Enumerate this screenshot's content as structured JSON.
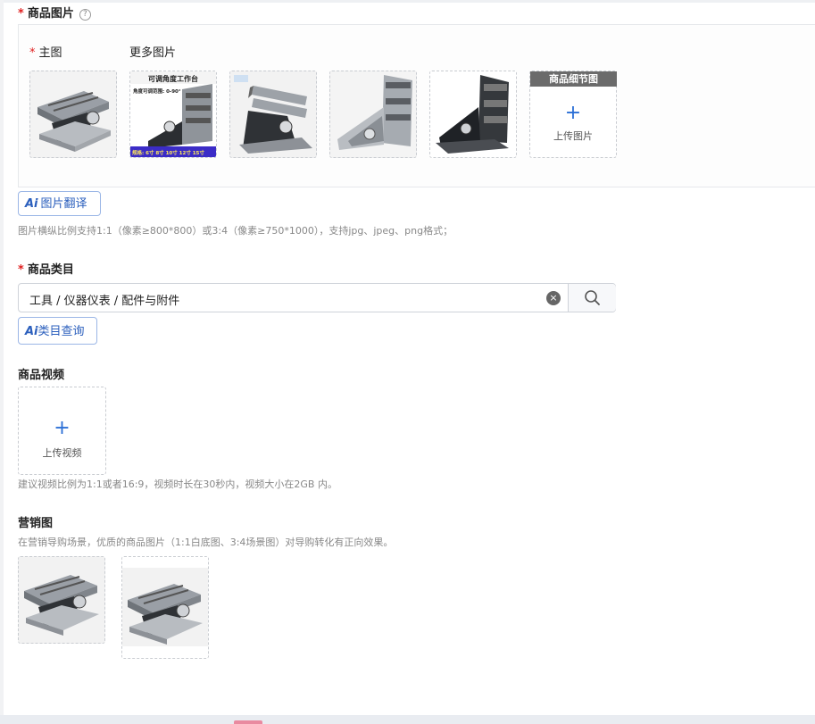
{
  "images_section": {
    "label": "商品图片",
    "help": "?",
    "main_label": "主图",
    "more_label": "更多图片",
    "detail_tag": "商品细节图",
    "upload_plus": "+",
    "upload_text": "上传图片",
    "ai_icon": "Ai",
    "translate_label": "图片翻译",
    "hint": "图片横纵比例支持1:1（像素≥800*800）或3:4（像素≥750*1000），支持jpg、jpeg、png格式；"
  },
  "thumb2_texts": {
    "title": "可调角度工作台",
    "subtitle": "角度可调范围: 0-90°",
    "banner": "规格: 6寸 8寸 10寸 12寸 15寸"
  },
  "category_section": {
    "label": "商品类目",
    "value": "工具 / 仪器仪表 / 配件与附件",
    "clear_icon": "×",
    "ai_icon": "Ai",
    "query_label": "类目查询"
  },
  "video_section": {
    "label": "商品视频",
    "upload_plus": "+",
    "upload_text": "上传视频",
    "hint": "建议视频比例为1:1或者16:9，视频时长在30秒内，视频大小在2GB 内。"
  },
  "marketing_section": {
    "label": "营销图",
    "hint": "在营销导购场景，优质的商品图片（1:1白底图、3:4场景图）对导购转化有正向效果。"
  },
  "colors": {
    "required": "#e02020",
    "accent": "#2b6fd6",
    "ai_blue": "#2b5fbd"
  }
}
